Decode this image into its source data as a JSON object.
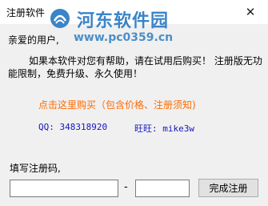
{
  "window": {
    "title": "注册软件",
    "close_glyph": "✕"
  },
  "watermark": {
    "title": "河东软件园",
    "url": "www.pc0359.cn"
  },
  "content": {
    "greeting": "亲爱的用户,",
    "message": "如果本软件对您有帮助，请在试用后购买！ 注册版无功能限制，免费升级、永久使用！",
    "buy_link": "点击这里购买（包含价格、注册须知)",
    "qq": "QQ: 348318920",
    "wangwang": "旺旺: mike3w"
  },
  "registration": {
    "label": "填写注册码,",
    "part1_value": "",
    "separator": "-",
    "part2_value": "",
    "finish_label": "完成注册"
  },
  "colors": {
    "link": "#ff6a00",
    "contact": "#1515c0",
    "watermark": "#3a84c9"
  }
}
